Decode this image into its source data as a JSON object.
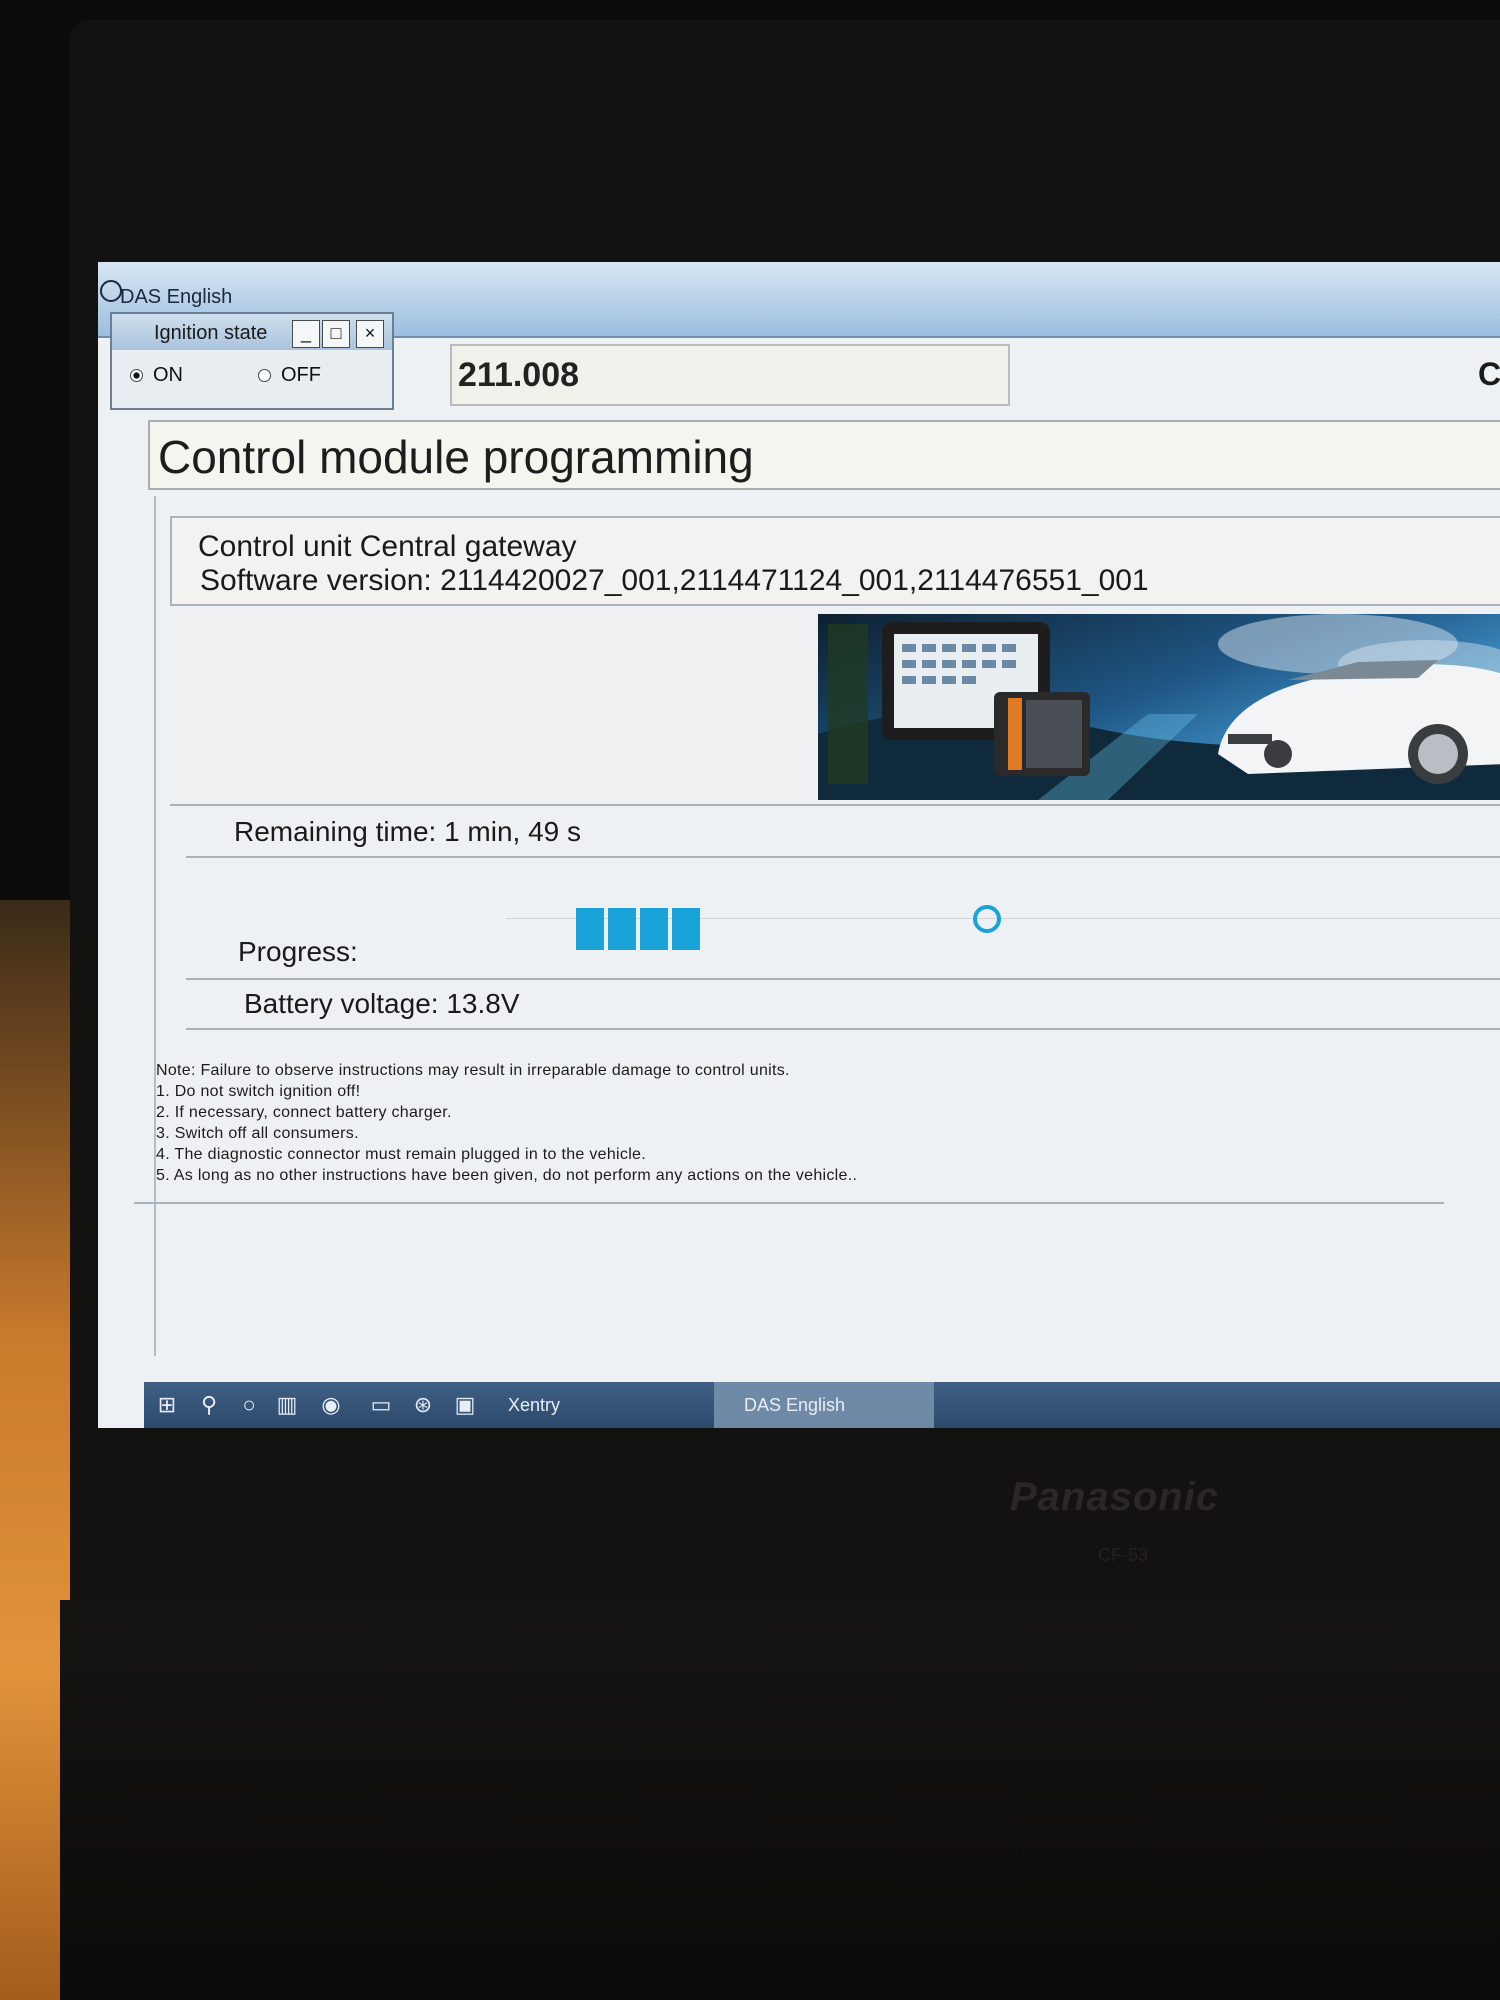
{
  "window": {
    "title": "DAS English"
  },
  "ignition": {
    "title": "Ignition state",
    "minimize": "_",
    "maximize": "□",
    "close": "×",
    "on_label": "ON",
    "off_label": "OFF",
    "selected": "ON"
  },
  "header": {
    "code": "211.008",
    "right_edge_text": "C"
  },
  "main": {
    "title": "Control module programming",
    "control_unit": "Control unit Central gateway",
    "software_version": "Software version: 2114420027_001,2114471124_001,2114476551_001",
    "remaining_time": "Remaining time: 1 min, 49 s",
    "progress_label": "Progress:",
    "progress_segments": 4,
    "battery_voltage": "Battery voltage: 13.8V",
    "notes": [
      "Note:  Failure to observe instructions may result in irreparable damage to control units.",
      "1. Do not switch ignition off!",
      "2. If necessary, connect battery charger.",
      "3. Switch off all consumers.",
      "4. The diagnostic connector must remain plugged in to the vehicle.",
      "5. As long as no other instructions have been given, do not perform any actions on the vehicle.."
    ]
  },
  "taskbar": {
    "icons": [
      "windows-start-icon",
      "search-icon",
      "cortana-icon",
      "task-view-icon",
      "chrome-icon",
      "file-explorer-icon",
      "mercedes-star-icon",
      "app-window-icon"
    ],
    "tasks": [
      {
        "label": "Xentry",
        "active": true
      },
      {
        "label": "DAS English",
        "active": false
      }
    ]
  },
  "hardware": {
    "brand": "Panasonic",
    "model": "CF-53"
  },
  "colors": {
    "progress": "#1aa3d8",
    "titlebar": "#9cbedf",
    "taskbar": "#2d4a6c"
  }
}
